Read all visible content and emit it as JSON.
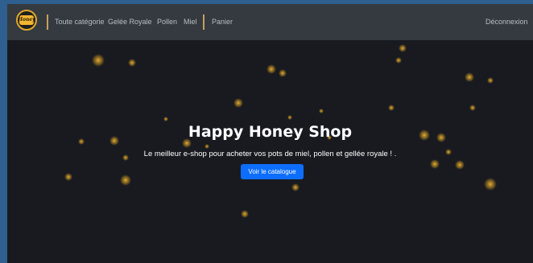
{
  "nav": {
    "logo_text": "Honey",
    "items": [
      {
        "label": "Toute catégorie"
      },
      {
        "label": "Gelée Royale"
      },
      {
        "label": "Pollen"
      },
      {
        "label": "Miel"
      }
    ],
    "cart_label": "Panier",
    "logout_label": "Déconnexion"
  },
  "hero": {
    "title": "Happy Honey Shop",
    "subtitle": "Le meilleur e-shop pour acheter vos pots de miel, pollen et gellée royale ! .",
    "button_label": "Voir le catalogue"
  },
  "colors": {
    "navbar": "#343a40",
    "hero_bg": "#181a20",
    "accent_button": "#0d6efd",
    "bokeh": "#e0a92b"
  }
}
